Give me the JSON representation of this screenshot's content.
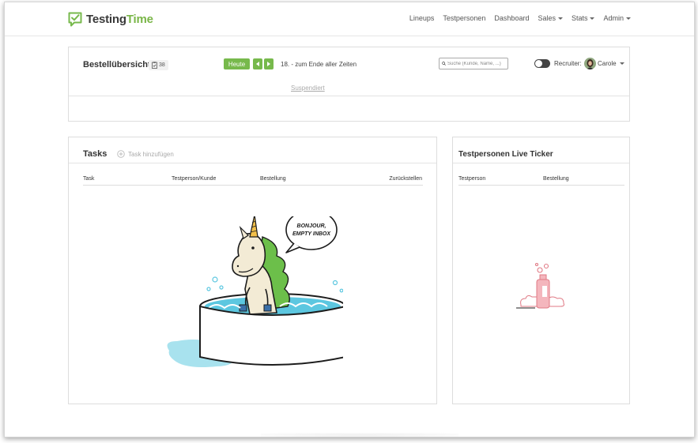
{
  "brand": {
    "name_part1": "Testing",
    "name_part2": "Time",
    "accent_color": "#77b94c"
  },
  "nav": {
    "items": [
      {
        "label": "Lineups",
        "dropdown": false
      },
      {
        "label": "Testpersonen",
        "dropdown": false
      },
      {
        "label": "Dashboard",
        "dropdown": false
      },
      {
        "label": "Sales",
        "dropdown": true
      },
      {
        "label": "Stats",
        "dropdown": true
      },
      {
        "label": "Admin",
        "dropdown": true
      }
    ]
  },
  "order_overview": {
    "title": "Bestellübersicht",
    "count": "38",
    "today_label": "Heute",
    "date_range": "18. - zum Ende aller Zeiten",
    "search_placeholder": "Suche (Kunde, Name, ...)",
    "recruiter_label": "Recruiter:",
    "recruiter_name": "Carole",
    "suspended_link": "Suspendiert"
  },
  "tasks": {
    "title": "Tasks",
    "add_label": "Task hinzufügen",
    "columns": [
      "Task",
      "Testperson/Kunde",
      "Bestellung",
      "Zurückstellen"
    ],
    "empty_bubble_line1": "BONJOUR,",
    "empty_bubble_line2": "EMPTY INBOX"
  },
  "ticker": {
    "title": "Testpersonen Live Ticker",
    "columns": [
      "Testperson",
      "Bestellung"
    ]
  }
}
